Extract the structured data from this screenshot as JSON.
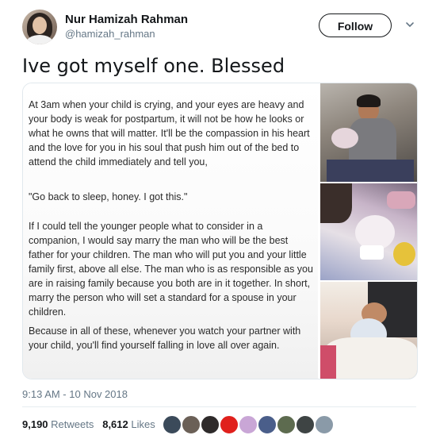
{
  "author": {
    "name": "Nur Hamizah Rahman",
    "handle": "@hamizah_rahman"
  },
  "follow_label": "Follow",
  "tweet_text": "Ive got myself one. Blessed",
  "media": {
    "paragraphs": [
      "At 3am when your child is crying, and your eyes are heavy and your body is weak for postpartum, it will not be how he looks or what he owns that will matter. It'll be the compassion in his heart and the love for you in his soul that push him out of the bed to attend the child immediately and tell you,",
      "\"Go back to sleep, honey. I got this.\"",
      "If I could tell the younger people what to consider in a companion, I would say marry the man who will be the best father for your children. The man who will put you and your little family first, above all else. The man who is as responsible as you are in raising family because you both are in it together. In short, marry the person who will set a standard for a spouse in your children.",
      "Because in all of these, whenever you watch your partner with your child, you'll find yourself falling in love all over again."
    ],
    "photo_count": 3
  },
  "timestamp": "9:13 AM - 10 Nov 2018",
  "stats": {
    "retweets_count": "9,190",
    "retweets_label": "Retweets",
    "likes_count": "8,612",
    "likes_label": "Likes"
  },
  "likers": [
    {
      "color": "#3b4a5a"
    },
    {
      "color": "#6b6057"
    },
    {
      "color": "#2e2a2a"
    },
    {
      "color": "#e0201c"
    },
    {
      "color": "#c9a6d6"
    },
    {
      "color": "#4a5e8a"
    },
    {
      "color": "#5d6b4f"
    },
    {
      "color": "#3e4444"
    },
    {
      "color": "#8a9aa8"
    }
  ]
}
